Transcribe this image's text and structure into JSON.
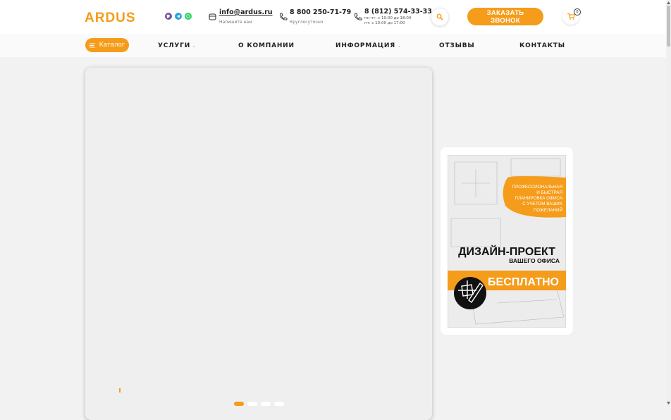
{
  "header": {
    "logo_text": "ARDUS",
    "email": {
      "address": "info@ardus.ru",
      "note": "Напишите нам"
    },
    "phone1": {
      "number": "8 800 250-71-79",
      "note": "Круглосуточно"
    },
    "phone2": {
      "number": "8 (812) 574-33-33",
      "hours1": "пн-чт: с 10:00 до 18:00",
      "hours2": "пт: с 10:00 до 17:00"
    },
    "call_button": "ЗАКАЗАТЬ ЗВОНОК",
    "cart_count": "0"
  },
  "messengers": [
    {
      "name": "viber-icon",
      "color": "#7b519d"
    },
    {
      "name": "telegram-icon",
      "color": "#2aa3da"
    },
    {
      "name": "whatsapp-icon",
      "color": "#25d366"
    }
  ],
  "nav": {
    "catalog": "Каталог",
    "items": [
      "УСЛУГИ",
      "О КОМПАНИИ",
      "ИНФОРМАЦИЯ",
      "ОТЗЫВЫ",
      "КОНТАКТЫ"
    ]
  },
  "banner": {
    "badge": [
      "ПРОФЕССИОНАЛЬНАЯ",
      "И БЫСТРАЯ",
      "ПЛАНИРОВКА ОФИСА",
      "С УЧЕТОМ ВАШИХ",
      "ПОЖЕЛАНИЙ"
    ],
    "title": "ДИЗАЙН-ПРОЕКТ",
    "subtitle": "ВАШЕГО ОФИСА",
    "strip": "БЕСПЛАТНО"
  },
  "colors": {
    "accent": "#f59c1a",
    "logo_grey": "#9a9a9a"
  },
  "slider": {
    "dots": 4,
    "active": 1
  }
}
